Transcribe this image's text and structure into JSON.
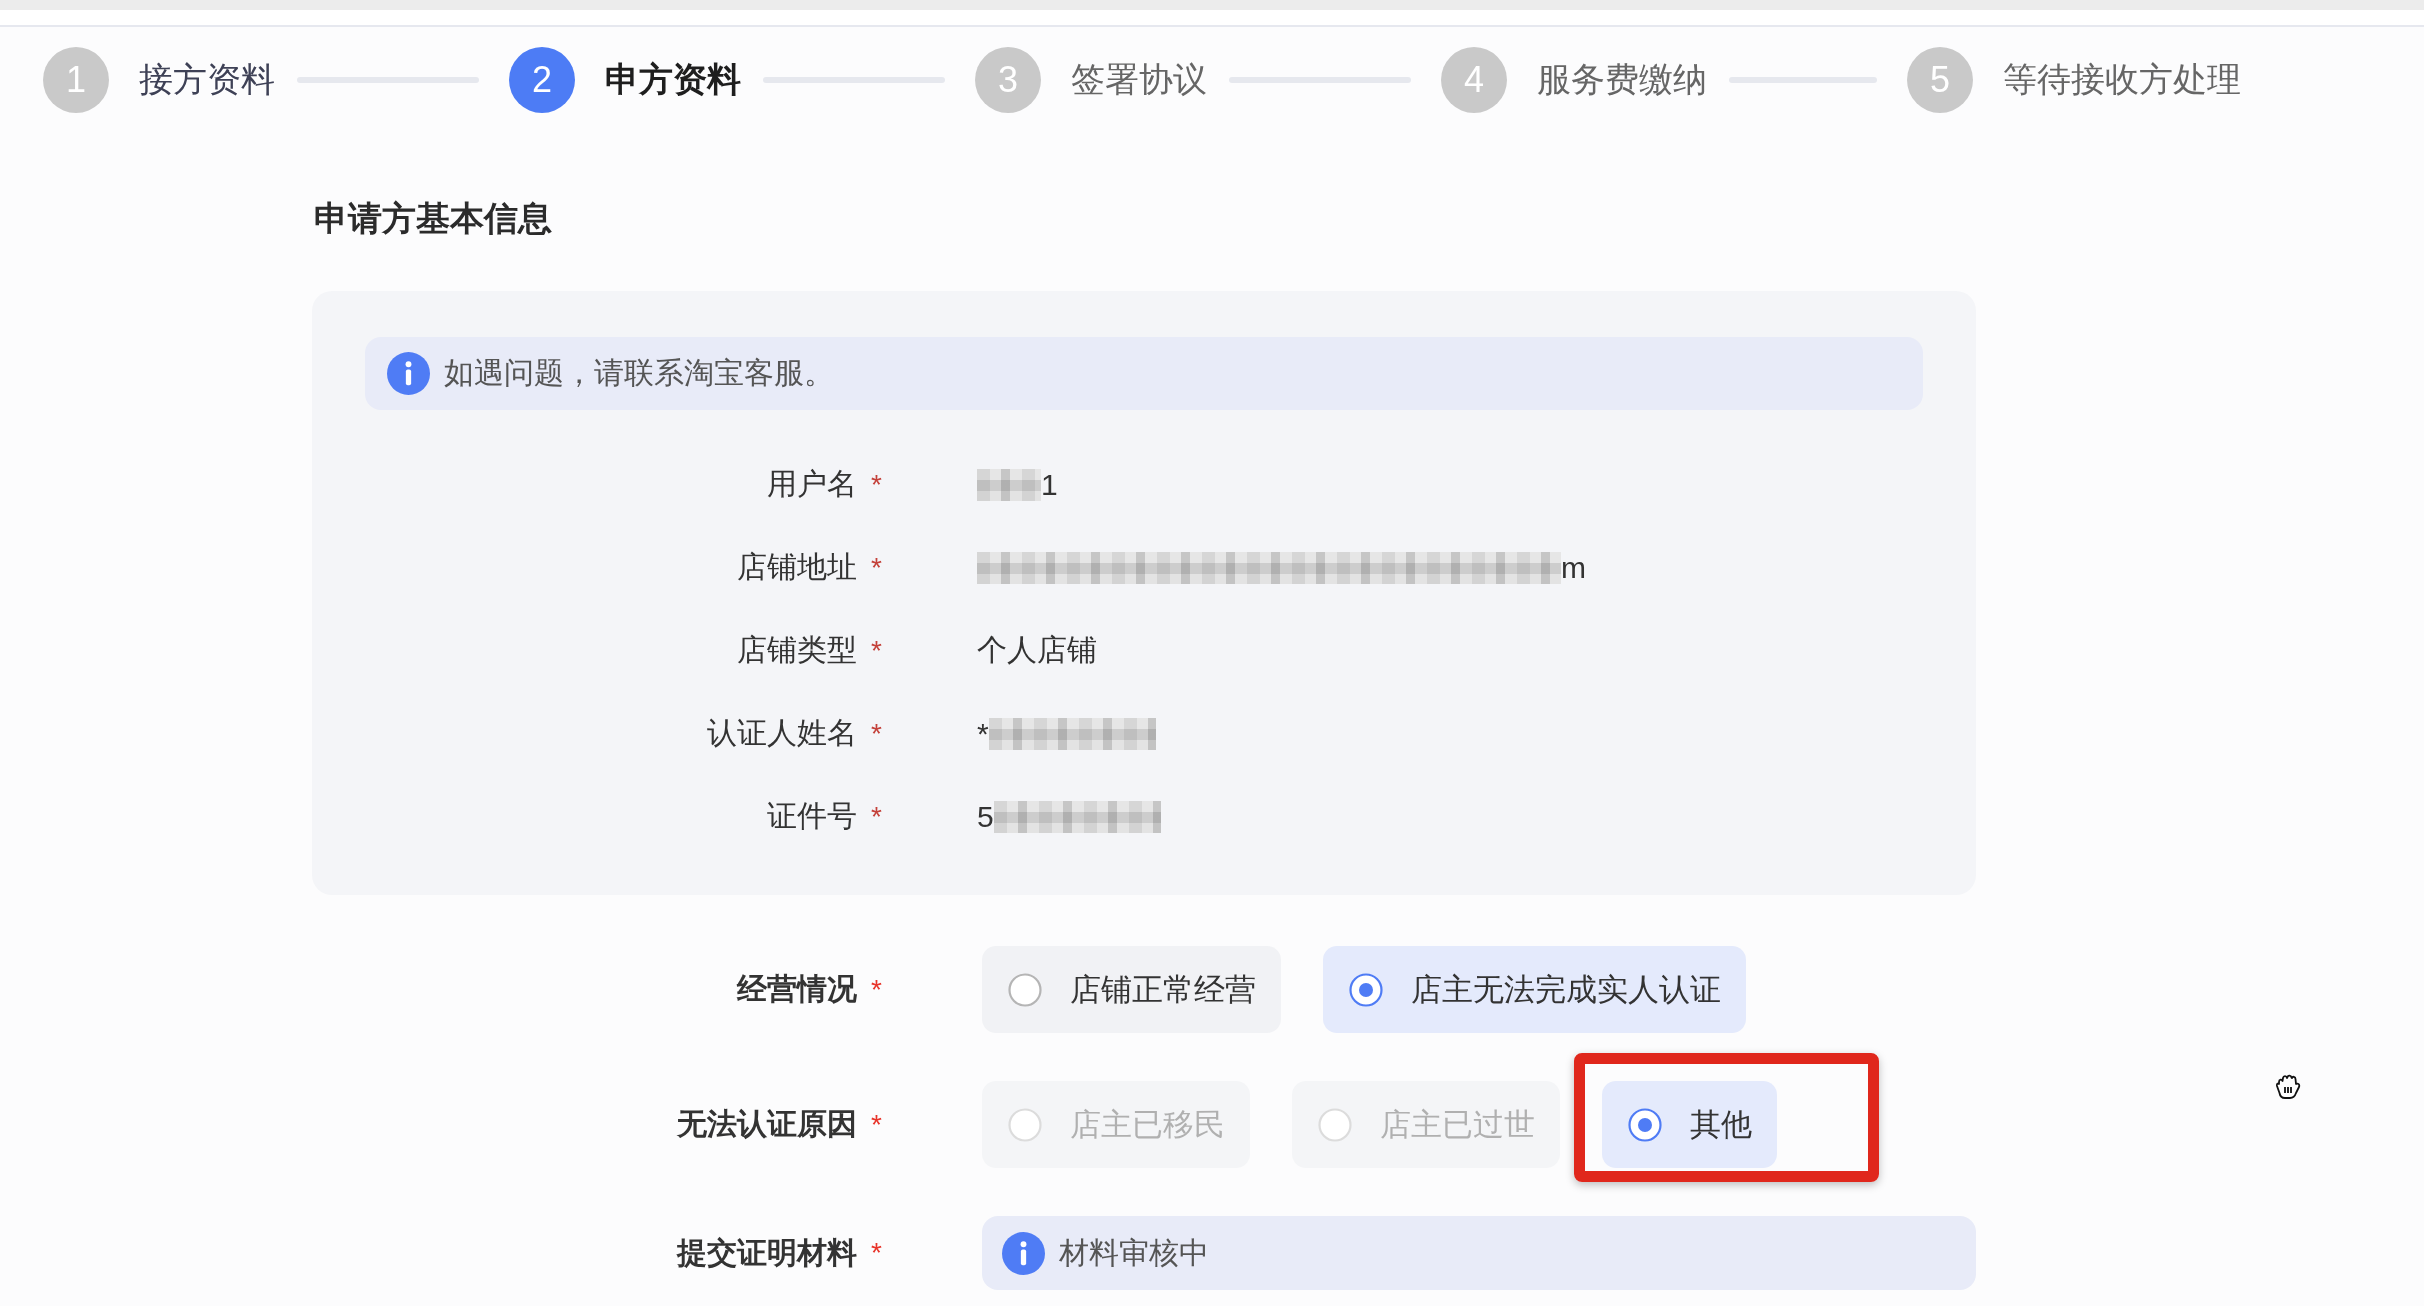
{
  "steps": [
    {
      "number": "1",
      "label": "接方资料",
      "active": false,
      "completed": true
    },
    {
      "number": "2",
      "label": "申方资料",
      "active": true,
      "completed": false
    },
    {
      "number": "3",
      "label": "签署协议",
      "active": false,
      "completed": false
    },
    {
      "number": "4",
      "label": "服务费缴纳",
      "active": false,
      "completed": false
    },
    {
      "number": "5",
      "label": "等待接收方处理",
      "active": false,
      "completed": false
    }
  ],
  "basic_info": {
    "title": "申请方基本信息",
    "notice": "如遇问题，请联系淘宝客服。",
    "fields": [
      {
        "label": "用户名",
        "required_mark": "*",
        "parts": [
          {
            "kind": "mask_short"
          },
          {
            "kind": "text",
            "text": "1"
          }
        ]
      },
      {
        "label": "店铺地址",
        "required_mark": "*",
        "parts": [
          {
            "kind": "mask_long"
          },
          {
            "kind": "text",
            "text": "m"
          }
        ]
      },
      {
        "label": "店铺类型",
        "required_mark": "*",
        "parts": [
          {
            "kind": "text",
            "text": "个人店铺"
          }
        ]
      },
      {
        "label": "认证人姓名",
        "required_mark": "*",
        "parts": [
          {
            "kind": "text",
            "text": "*"
          },
          {
            "kind": "mask_medium"
          }
        ]
      },
      {
        "label": "证件号",
        "required_mark": "*",
        "parts": [
          {
            "kind": "text",
            "text": "5"
          },
          {
            "kind": "mask_medium"
          }
        ]
      }
    ]
  },
  "form": {
    "rows": [
      {
        "kind": "radio",
        "label": "经营情况",
        "required_mark": "*",
        "options": [
          {
            "label": "店铺正常经营",
            "selected": false,
            "disabled": false,
            "highlighted": false
          },
          {
            "label": "店主无法完成实人认证",
            "selected": true,
            "disabled": false,
            "highlighted": false
          }
        ]
      },
      {
        "kind": "radio",
        "label": "无法认证原因",
        "required_mark": "*",
        "options": [
          {
            "label": "店主已移民",
            "selected": false,
            "disabled": true,
            "highlighted": false
          },
          {
            "label": "店主已过世",
            "selected": false,
            "disabled": true,
            "highlighted": false
          },
          {
            "label": "其他",
            "selected": true,
            "disabled": false,
            "highlighted": true
          }
        ]
      },
      {
        "kind": "status",
        "label": "提交证明材料",
        "required_mark": "*",
        "text": "材料审核中"
      }
    ]
  }
}
